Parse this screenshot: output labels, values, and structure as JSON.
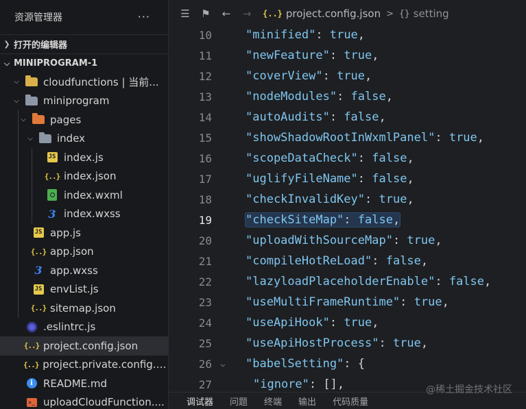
{
  "sidebar": {
    "title": "资源管理器",
    "more": "···",
    "open_editors": "打开的编辑器",
    "workspace": "MINIPROGRAM-1",
    "tree": [
      {
        "label": "cloudfunctions | 当前...",
        "icon": "cloud-folder-icon"
      },
      {
        "label": "miniprogram",
        "icon": "folder-icon"
      },
      {
        "label": "pages",
        "icon": "pages-folder-icon"
      },
      {
        "label": "index",
        "icon": "folder-icon"
      },
      {
        "label": "index.js",
        "icon": "js-file-icon"
      },
      {
        "label": "index.json",
        "icon": "json-file-icon"
      },
      {
        "label": "index.wxml",
        "icon": "wxml-file-icon"
      },
      {
        "label": "index.wxss",
        "icon": "css-file-icon"
      },
      {
        "label": "app.js",
        "icon": "js-file-icon"
      },
      {
        "label": "app.json",
        "icon": "json-file-icon"
      },
      {
        "label": "app.wxss",
        "icon": "css-file-icon"
      },
      {
        "label": "envList.js",
        "icon": "js-file-icon"
      },
      {
        "label": "sitemap.json",
        "icon": "json-file-icon"
      },
      {
        "label": ".eslintrc.js",
        "icon": "eslint-file-icon"
      },
      {
        "label": "project.config.json",
        "icon": "json-file-icon"
      },
      {
        "label": "project.private.config.js...",
        "icon": "json-file-icon"
      },
      {
        "label": "README.md",
        "icon": "info-file-icon"
      },
      {
        "label": "uploadCloudFunction....",
        "icon": "terminal-file-icon"
      }
    ]
  },
  "editor": {
    "breadcrumb": {
      "file_icon": "{..}",
      "file": "project.config.json",
      "sep": ">",
      "obj_icon": "{}",
      "node": "setting"
    },
    "lines": [
      {
        "n": "10",
        "key": "\"minified\"",
        "val": "true",
        "end": ","
      },
      {
        "n": "11",
        "key": "\"newFeature\"",
        "val": "true",
        "end": ","
      },
      {
        "n": "12",
        "key": "\"coverView\"",
        "val": "true",
        "end": ","
      },
      {
        "n": "13",
        "key": "\"nodeModules\"",
        "val": "false",
        "end": ","
      },
      {
        "n": "14",
        "key": "\"autoAudits\"",
        "val": "false",
        "end": ","
      },
      {
        "n": "15",
        "key": "\"showShadowRootInWxmlPanel\"",
        "val": "true",
        "end": ","
      },
      {
        "n": "16",
        "key": "\"scopeDataCheck\"",
        "val": "false",
        "end": ","
      },
      {
        "n": "17",
        "key": "\"uglifyFileName\"",
        "val": "false",
        "end": ","
      },
      {
        "n": "18",
        "key": "\"checkInvalidKey\"",
        "val": "true",
        "end": ","
      },
      {
        "n": "19",
        "key": "\"checkSiteMap\"",
        "val": "false",
        "end": ","
      },
      {
        "n": "20",
        "key": "\"uploadWithSourceMap\"",
        "val": "true",
        "end": ","
      },
      {
        "n": "21",
        "key": "\"compileHotReLoad\"",
        "val": "false",
        "end": ","
      },
      {
        "n": "22",
        "key": "\"lazyloadPlaceholderEnable\"",
        "val": "false",
        "end": ","
      },
      {
        "n": "23",
        "key": "\"useMultiFrameRuntime\"",
        "val": "true",
        "end": ","
      },
      {
        "n": "24",
        "key": "\"useApiHook\"",
        "val": "true",
        "end": ","
      },
      {
        "n": "25",
        "key": "\"useApiHostProcess\"",
        "val": "true",
        "end": ","
      },
      {
        "n": "26",
        "key": "\"babelSetting\"",
        "val": "{",
        "end": ""
      },
      {
        "n": "27",
        "key": "\"ignore\"",
        "val": "[]",
        "end": ","
      }
    ]
  },
  "panel": {
    "tabs": [
      "调试器",
      "问题",
      "终端",
      "输出",
      "代码质量"
    ]
  },
  "watermark": "@稀土掘金技术社区"
}
